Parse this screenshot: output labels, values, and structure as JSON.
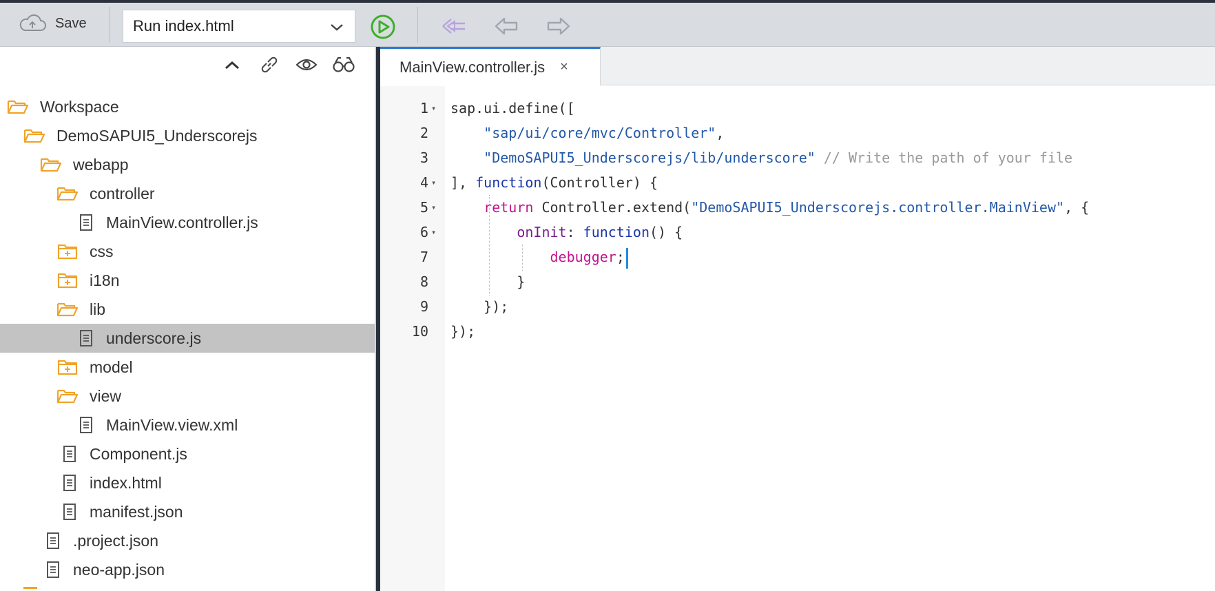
{
  "toolbar": {
    "save_label": "Save",
    "run_select_value": "Run index.html"
  },
  "explorer": {
    "tree": [
      {
        "label": "Workspace",
        "type": "folder-open",
        "level": 0
      },
      {
        "label": "DemoSAPUI5_Underscorejs",
        "type": "folder-open",
        "level": 1
      },
      {
        "label": "webapp",
        "type": "folder-open",
        "level": 2
      },
      {
        "label": "controller",
        "type": "folder-open",
        "level": 3
      },
      {
        "label": "MainView.controller.js",
        "type": "file",
        "level": 4
      },
      {
        "label": "css",
        "type": "folder-closed",
        "level": 3
      },
      {
        "label": "i18n",
        "type": "folder-closed",
        "level": 3
      },
      {
        "label": "lib",
        "type": "folder-open",
        "level": 3
      },
      {
        "label": "underscore.js",
        "type": "file",
        "level": 4,
        "selected": true
      },
      {
        "label": "model",
        "type": "folder-closed",
        "level": 3
      },
      {
        "label": "view",
        "type": "folder-open",
        "level": 3
      },
      {
        "label": "MainView.view.xml",
        "type": "file",
        "level": 4
      },
      {
        "label": "Component.js",
        "type": "file",
        "level": 3
      },
      {
        "label": "index.html",
        "type": "file",
        "level": 3
      },
      {
        "label": "manifest.json",
        "type": "file",
        "level": 3
      },
      {
        "label": ".project.json",
        "type": "file",
        "level": 2
      },
      {
        "label": "neo-app.json",
        "type": "file",
        "level": 2
      }
    ]
  },
  "editor": {
    "tab_label": "MainView.controller.js",
    "tab_close": "×",
    "lines": [
      {
        "num": "1",
        "fold": true,
        "tokens": [
          [
            "p",
            "sap.ui.define(["
          ]
        ]
      },
      {
        "num": "2",
        "fold": false,
        "tokens": [
          [
            "p",
            "    "
          ],
          [
            "s",
            "\"sap/ui/core/mvc/Controller\""
          ],
          [
            "p",
            ","
          ]
        ]
      },
      {
        "num": "3",
        "fold": false,
        "tokens": [
          [
            "p",
            "    "
          ],
          [
            "s",
            "\"DemoSAPUI5_Underscorejs/lib/underscore\""
          ],
          [
            "p",
            " "
          ],
          [
            "c",
            "// Write the path of your file"
          ]
        ]
      },
      {
        "num": "4",
        "fold": true,
        "tokens": [
          [
            "p",
            "], "
          ],
          [
            "f",
            "function"
          ],
          [
            "p",
            "(Controller) {"
          ]
        ]
      },
      {
        "num": "5",
        "fold": true,
        "tokens": [
          [
            "p",
            "    "
          ],
          [
            "k",
            "return"
          ],
          [
            "p",
            " Controller.extend("
          ],
          [
            "s",
            "\"DemoSAPUI5_Underscorejs.controller.MainView\""
          ],
          [
            "p",
            ", {"
          ]
        ]
      },
      {
        "num": "6",
        "fold": true,
        "tokens": [
          [
            "p",
            "        "
          ],
          [
            "m",
            "onInit"
          ],
          [
            "p",
            ": "
          ],
          [
            "f",
            "function"
          ],
          [
            "p",
            "() {"
          ]
        ]
      },
      {
        "num": "7",
        "fold": false,
        "tokens": [
          [
            "p",
            "            "
          ],
          [
            "k",
            "debugger"
          ],
          [
            "p",
            ";"
          ]
        ],
        "cursor": true
      },
      {
        "num": "8",
        "fold": false,
        "tokens": [
          [
            "p",
            "        }"
          ]
        ]
      },
      {
        "num": "9",
        "fold": false,
        "tokens": [
          [
            "p",
            "    });"
          ]
        ]
      },
      {
        "num": "10",
        "fold": false,
        "tokens": [
          [
            "p",
            "});"
          ]
        ]
      }
    ]
  },
  "colors": {
    "folder": "#f0a428",
    "run": "#3fae2a",
    "string": "#2358a8",
    "keyword": "#c3148e",
    "function": "#1b36a8",
    "comment": "#999999",
    "cursor": "#1f8ee0"
  },
  "icons": [
    "cloud-upload-icon",
    "chevron-down-icon",
    "run-icon",
    "step-back-icon",
    "navigate-back-icon",
    "navigate-forward-icon",
    "collapse-all-icon",
    "link-icon",
    "eye-icon",
    "binoculars-icon",
    "folder-open-icon",
    "folder-closed-icon",
    "file-icon"
  ]
}
